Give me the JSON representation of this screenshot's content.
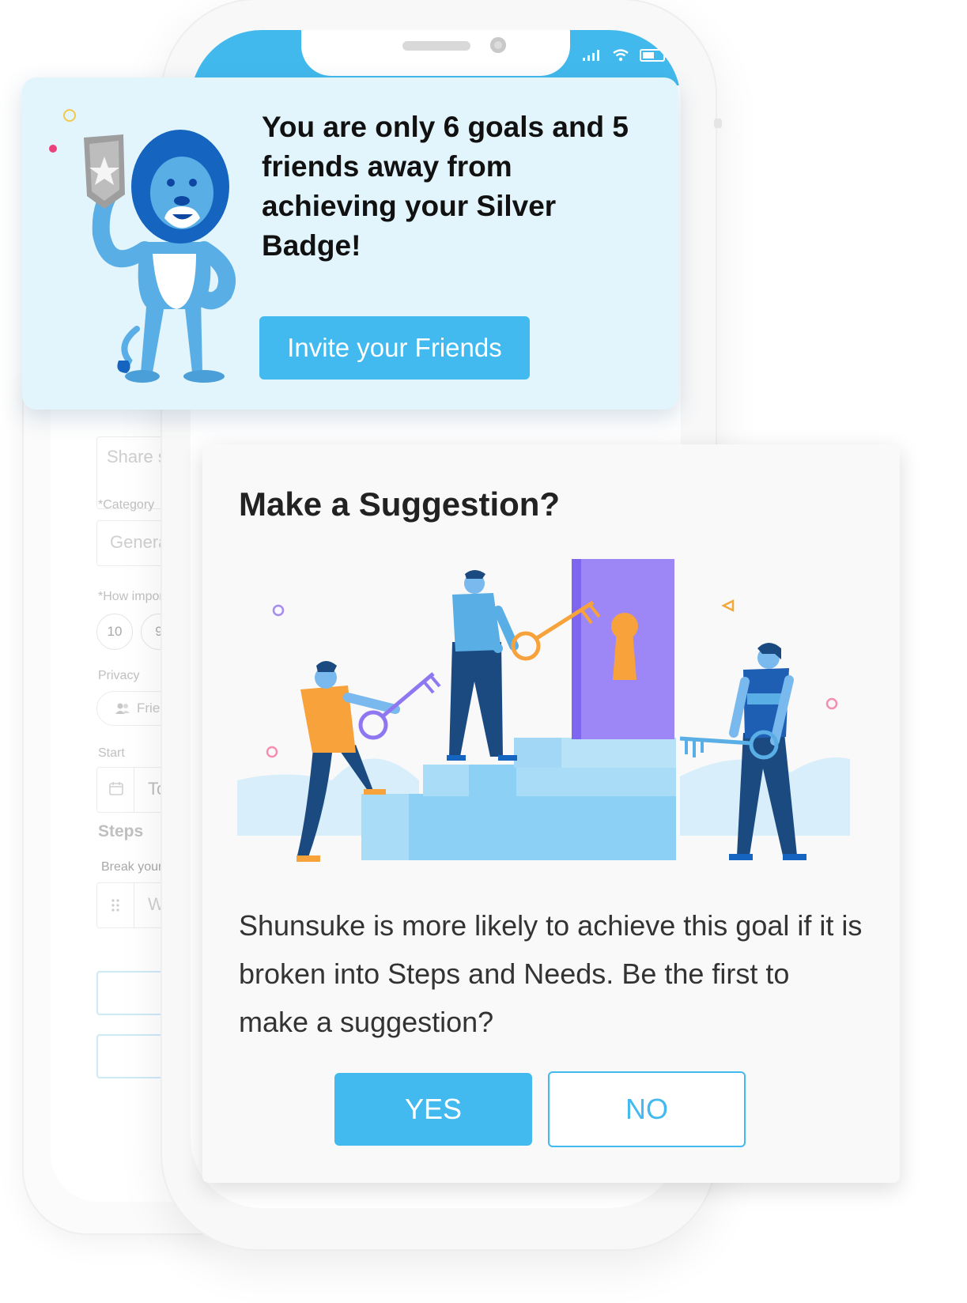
{
  "badge_card": {
    "message": "You are only 6 goals and 5 friends away from achieving your Silver Badge!",
    "invite_button_label": "Invite your Friends",
    "mascot_icon": "lion-holding-badge-icon"
  },
  "background_form": {
    "share_placeholder": "Share som",
    "category_label": "*Category",
    "category_value": "General",
    "importance_label": "*How importar",
    "importance_options": [
      "10",
      "9"
    ],
    "privacy_label": "Privacy",
    "privacy_value": "Friends",
    "start_label": "Start",
    "start_value": "Toda",
    "steps_heading": "Steps",
    "steps_hint": "Break your goa",
    "step_placeholder": "What"
  },
  "suggestion_card": {
    "title": "Make a Suggestion?",
    "body": "Shunsuke is more likely to achieve this goal if it is broken into Steps and Needs. Be the first to make a suggestion?",
    "yes_label": "YES",
    "no_label": "NO",
    "illustration": "people-climbing-stairs-with-keys-illustration"
  },
  "colors": {
    "accent": "#42baf0",
    "badge_bg": "#e3f5fc",
    "card_bg": "#f9f9f9",
    "status_bar": "#42b9ec"
  }
}
